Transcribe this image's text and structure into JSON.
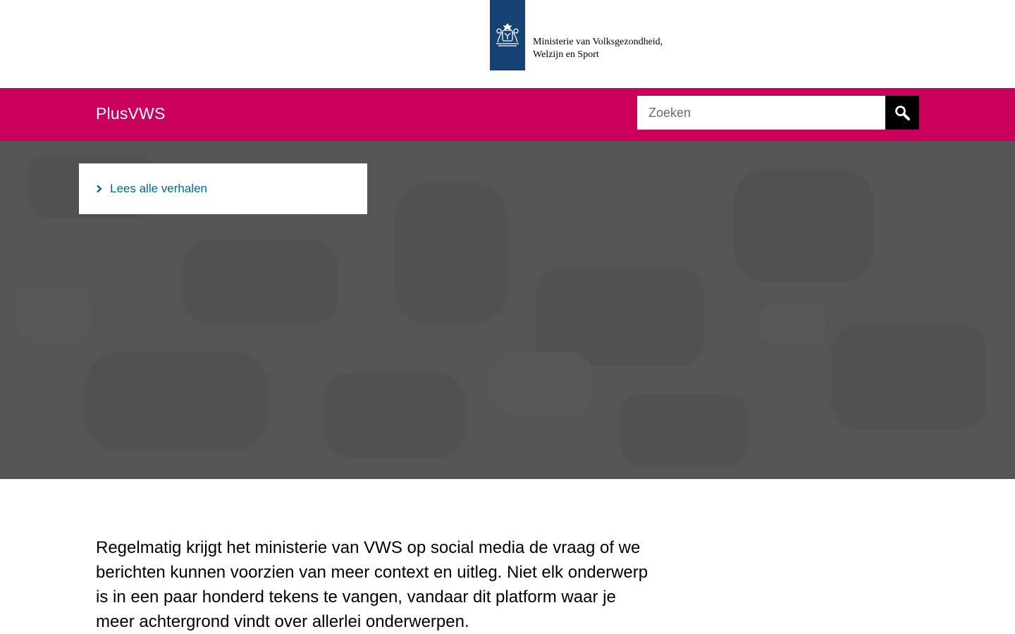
{
  "header": {
    "ministry_line1": "Ministerie van Volksgezondheid,",
    "ministry_line2": "Welzijn en Sport",
    "logo_icon": "coat-of-arms-icon"
  },
  "nav": {
    "site_title": "PlusVWS",
    "search": {
      "placeholder": "Zoeken",
      "value": "",
      "button_icon": "search-icon"
    },
    "color": "#ca005d"
  },
  "hero": {
    "link_label": "Lees alle verhalen",
    "link_icon": "chevron-right-icon"
  },
  "intro": {
    "text": "Regelmatig krijgt het ministerie van VWS op social media de vraag of we berichten kunnen voorzien van meer context en uitleg. Niet elk onderwerp is in een paar honderd tekens te vangen, vandaar dit platform waar je meer achtergrond vindt over allerlei onderwerpen."
  },
  "colors": {
    "brand_blue": "#154273",
    "accent_pink": "#ca005d",
    "link_blue": "#01689b",
    "hero_gray": "#555555"
  }
}
